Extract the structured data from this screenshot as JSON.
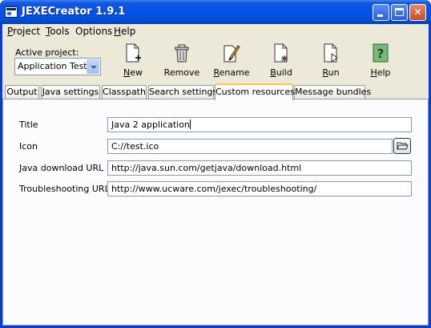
{
  "window": {
    "title": "JEXECreator 1.9.1"
  },
  "menu": [
    {
      "label": "Project",
      "accel": "P",
      "rest": "roject"
    },
    {
      "label": "Tools",
      "accel": "T",
      "rest": "ools"
    },
    {
      "label": "Options",
      "accel": "",
      "rest": "Options"
    },
    {
      "label": "Help",
      "accel": "H",
      "rest": "elp"
    }
  ],
  "project": {
    "active_label": "Active project:",
    "selected": "Application Test"
  },
  "toolbar": [
    {
      "label": "New",
      "accel": "N",
      "rest": "ew",
      "icon": "new-document-icon"
    },
    {
      "label": "Remove",
      "accel": "",
      "rest": "Remove",
      "icon": "trash-icon"
    },
    {
      "label": "Rename",
      "accel": "R",
      "rest": "ename",
      "icon": "rename-pencil-icon"
    },
    {
      "label": "Build",
      "accel": "B",
      "rest": "uild",
      "icon": "build-icon"
    },
    {
      "label": "Run",
      "accel": "R",
      "rest": "un",
      "icon": "run-icon"
    },
    {
      "label": "Help",
      "accel": "H",
      "rest": "elp",
      "icon": "help-icon"
    }
  ],
  "tabs": [
    {
      "label": "Output"
    },
    {
      "label": "Java settings"
    },
    {
      "label": "Classpath"
    },
    {
      "label": "Search settings"
    },
    {
      "label": "Custom resources",
      "active": true
    },
    {
      "label": "Message bundles"
    }
  ],
  "fields": {
    "title": {
      "label": "Title",
      "value": "Java 2 application"
    },
    "icon": {
      "label": "Icon",
      "value": "C://test.ico"
    },
    "java_download_url": {
      "label": "Java download URL",
      "value": "http://java.sun.com/getjava/download.html"
    },
    "troubleshooting_url": {
      "label": "Troubleshooting URL",
      "value": "http://www.ucware.com/jexec/troubleshooting/"
    }
  },
  "colors": {
    "titlebar": "#0553e6",
    "tab_active_accent": "#ffc83c",
    "client_bg": "#ece9d8"
  }
}
